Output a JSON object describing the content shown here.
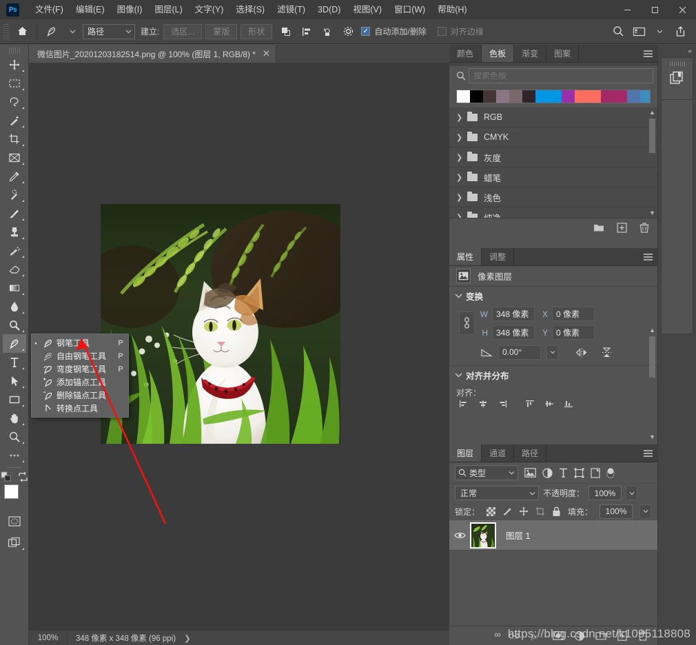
{
  "app": {
    "logo_text": "Ps",
    "menus": [
      {
        "label": "文件(F)"
      },
      {
        "label": "编辑(E)"
      },
      {
        "label": "图像(I)"
      },
      {
        "label": "图层(L)"
      },
      {
        "label": "文字(Y)"
      },
      {
        "label": "选择(S)"
      },
      {
        "label": "滤镜(T)"
      },
      {
        "label": "3D(D)"
      },
      {
        "label": "视图(V)"
      },
      {
        "label": "窗口(W)"
      },
      {
        "label": "帮助(H)"
      }
    ],
    "window_controls": {
      "minimize": "—",
      "maximize": "▭",
      "close": "✕"
    }
  },
  "options_bar": {
    "home_icon": "home-icon",
    "tool_icon": "pen-tool-icon",
    "mode_select": "路径",
    "make_label": "建立:",
    "buttons": [
      {
        "label": "选区..."
      },
      {
        "label": "蒙版"
      },
      {
        "label": "形状"
      }
    ],
    "auto_add_delete": {
      "label": "自动添加/删除",
      "checked": true,
      "mark": "✓"
    },
    "align_edges": {
      "label": "对齐边缘",
      "checked": false
    },
    "right_icons": [
      "search-icon",
      "workspace-icon",
      "chevron-down-icon",
      "share-icon"
    ]
  },
  "toolbar": {
    "tools": [
      {
        "name": "move-tool"
      },
      {
        "name": "marquee-tool"
      },
      {
        "name": "lasso-tool"
      },
      {
        "name": "magic-wand-tool"
      },
      {
        "name": "crop-tool"
      },
      {
        "name": "frame-tool"
      },
      {
        "name": "eyedropper-tool"
      },
      {
        "name": "healing-brush-tool"
      },
      {
        "name": "brush-tool"
      },
      {
        "name": "clone-stamp-tool"
      },
      {
        "name": "history-brush-tool"
      },
      {
        "name": "eraser-tool"
      },
      {
        "name": "gradient-tool"
      },
      {
        "name": "blur-tool"
      },
      {
        "name": "dodge-tool"
      },
      {
        "name": "pen-tool",
        "active": true
      },
      {
        "name": "type-tool"
      },
      {
        "name": "path-selection-tool"
      },
      {
        "name": "rectangle-tool"
      },
      {
        "name": "hand-tool"
      },
      {
        "name": "zoom-tool"
      },
      {
        "name": "more-tools"
      }
    ],
    "foreground_color": "#ffffff",
    "background_color": "#000000"
  },
  "flyout_menu": {
    "items": [
      {
        "label": "钢笔工具",
        "key": "P",
        "selected": true
      },
      {
        "label": "自由钢笔工具",
        "key": "P",
        "selected": false
      },
      {
        "label": "弯度钢笔工具",
        "key": "P",
        "selected": false
      },
      {
        "label": "添加锚点工具",
        "key": "",
        "selected": false
      },
      {
        "label": "删除锚点工具",
        "key": "",
        "selected": false
      },
      {
        "label": "转换点工具",
        "key": "",
        "selected": false
      }
    ],
    "bullet": "▪"
  },
  "document": {
    "tab_title": "微信图片_20201203182514.png @ 100% (图层 1, RGB/8) *",
    "close_glyph": "✕",
    "image_alt": "cat-photo"
  },
  "status_bar": {
    "zoom": "100%",
    "dimensions": "348 像素 x 348 像素 (96 ppi)",
    "expand_glyph": "❯"
  },
  "swatches_panel": {
    "tabs": [
      {
        "label": "颜色",
        "active": false
      },
      {
        "label": "色板",
        "active": true
      },
      {
        "label": "渐变",
        "active": false
      },
      {
        "label": "图案",
        "active": false
      }
    ],
    "search_placeholder": "搜索色板",
    "colors": [
      "#ffffff",
      "#000000",
      "#453534",
      "#8a7683",
      "#7b686c",
      "#2e2429",
      "#0096e6",
      "#0096e6",
      "#9b2fab",
      "#fb6e5e",
      "#fb6e5e",
      "#a32a67",
      "#a32a67",
      "#4f77ad",
      "#3d8ec0"
    ],
    "folders": [
      {
        "label": "RGB"
      },
      {
        "label": "CMYK"
      },
      {
        "label": "灰度"
      },
      {
        "label": "蜡笔"
      },
      {
        "label": "浅色"
      },
      {
        "label": "纯净"
      }
    ],
    "footer_icons": [
      "new-folder-icon",
      "new-swatch-icon",
      "delete-icon"
    ]
  },
  "properties_panel": {
    "tabs": [
      {
        "label": "属性",
        "active": true
      },
      {
        "label": "调整",
        "active": false
      }
    ],
    "layer_kind": "像素图层",
    "transform": {
      "title": "变换",
      "w_label": "W",
      "w_value": "348 像素",
      "x_label": "X",
      "x_value": "0 像素",
      "h_label": "H",
      "h_value": "348 像素",
      "y_label": "Y",
      "y_value": "0 像素",
      "angle_value": "0.00°"
    },
    "align_section": {
      "title": "对齐并分布",
      "align_label": "对齐："
    }
  },
  "layers_panel": {
    "tabs": [
      {
        "label": "图层",
        "active": true
      },
      {
        "label": "通道",
        "active": false
      },
      {
        "label": "路径",
        "active": false
      }
    ],
    "filter_kind": "类型",
    "filter_icons": [
      "image-filter-icon",
      "adjustment-filter-icon",
      "text-filter-icon",
      "shape-filter-icon",
      "smart-object-filter-icon",
      "filter-toggle-icon"
    ],
    "blend_mode": "正常",
    "opacity_label": "不透明度：",
    "opacity_value": "100%",
    "lock_label": "锁定：",
    "lock_icons": [
      "lock-transparency-icon",
      "lock-image-icon",
      "lock-position-icon",
      "lock-artboard-icon",
      "lock-all-icon"
    ],
    "fill_label": "填充：",
    "fill_value": "100%",
    "layers": [
      {
        "name": "图层 1",
        "visible": true,
        "selected": true
      }
    ],
    "footer_icons": [
      "link-icon",
      "fx-icon",
      "mask-icon",
      "adjustment-icon",
      "group-icon",
      "new-layer-icon",
      "delete-layer-icon"
    ]
  },
  "rails": {
    "left_rail_icon": "history-icon",
    "right_rail_icon": "libraries-icon",
    "collapse_glyph": "«"
  },
  "watermark": {
    "link_glyph": "∞",
    "text": "https://blog.csdn.net/k1095118808"
  }
}
